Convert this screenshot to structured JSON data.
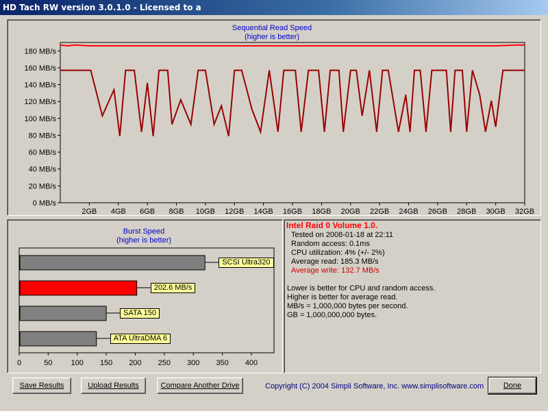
{
  "window": {
    "title": "HD Tach RW version 3.0.1.0 - Licensed to a"
  },
  "colors": {
    "accent_red": "#ff0000",
    "dark_red": "#990000",
    "bar_gray": "#808080",
    "label_bg": "#ffff99",
    "title_blue": "#0000cc"
  },
  "chart_data": [
    {
      "type": "line",
      "title": "Sequential Read Speed",
      "subtitle": "(higher is better)",
      "xlabel": "",
      "ylabel": "",
      "ylim": [
        0,
        190
      ],
      "xlim": [
        0,
        32
      ],
      "y_ticks": [
        "0 MB/s",
        "20 MB/s",
        "40 MB/s",
        "60 MB/s",
        "80 MB/s",
        "100 MB/s",
        "120 MB/s",
        "140 MB/s",
        "160 MB/s",
        "180 MB/s"
      ],
      "y_tick_values": [
        0,
        20,
        40,
        60,
        80,
        100,
        120,
        140,
        160,
        180
      ],
      "x_ticks": [
        "2GB",
        "4GB",
        "6GB",
        "8GB",
        "10GB",
        "12GB",
        "14GB",
        "16GB",
        "18GB",
        "20GB",
        "22GB",
        "24GB",
        "26GB",
        "28GB",
        "30GB",
        "32GB"
      ],
      "x_tick_values": [
        2,
        4,
        6,
        8,
        10,
        12,
        14,
        16,
        18,
        20,
        22,
        24,
        26,
        28,
        30,
        32
      ],
      "grid": false,
      "series": [
        {
          "name": "Average read",
          "color": "#ff0000",
          "x": [
            0,
            0.5,
            1,
            2,
            4,
            6,
            8,
            10,
            12,
            14,
            16,
            18,
            20,
            22,
            24,
            26,
            28,
            30,
            31.5,
            32
          ],
          "y": [
            187,
            186,
            187,
            186,
            186,
            186,
            186,
            186,
            186,
            186,
            186,
            186,
            186,
            186,
            186,
            186,
            186,
            186,
            187,
            187
          ]
        },
        {
          "name": "Average write",
          "color": "#990000",
          "x": [
            0,
            1.2,
            2.1,
            2.9,
            3.7,
            4.1,
            4.5,
            5.1,
            5.6,
            6.0,
            6.4,
            6.8,
            7.1,
            7.4,
            7.7,
            8.3,
            9.0,
            9.5,
            10.0,
            10.6,
            11.1,
            11.6,
            12.0,
            12.5,
            13.2,
            13.8,
            14.4,
            15.0,
            15.4,
            16.2,
            16.6,
            17.1,
            17.8,
            18.2,
            18.6,
            19.2,
            19.5,
            20.0,
            20.4,
            20.8,
            21.3,
            21.8,
            22.2,
            22.6,
            23.3,
            23.8,
            24.1,
            24.4,
            24.8,
            25.2,
            25.6,
            26.1,
            26.6,
            26.9,
            27.2,
            27.7,
            28.0,
            28.4,
            28.9,
            29.3,
            29.7,
            30.0,
            30.5,
            30.9,
            31.2,
            32
          ],
          "y": [
            157,
            157,
            157,
            103,
            134,
            79,
            157,
            157,
            84,
            142,
            79,
            157,
            157,
            157,
            93,
            122,
            93,
            157,
            157,
            93,
            115,
            79,
            157,
            157,
            111,
            84,
            157,
            84,
            157,
            157,
            84,
            157,
            157,
            84,
            157,
            157,
            84,
            157,
            157,
            103,
            157,
            84,
            157,
            157,
            84,
            128,
            84,
            157,
            157,
            84,
            157,
            157,
            157,
            84,
            157,
            157,
            84,
            157,
            128,
            84,
            121,
            90,
            157,
            157,
            157,
            157
          ]
        }
      ]
    },
    {
      "type": "bar",
      "orientation": "horizontal",
      "title": "Burst Speed",
      "subtitle": "(higher is better)",
      "xlim": [
        0,
        440
      ],
      "x_ticks": [
        "0",
        "50",
        "100",
        "150",
        "200",
        "250",
        "300",
        "350",
        "400"
      ],
      "x_tick_values": [
        0,
        50,
        100,
        150,
        200,
        250,
        300,
        350,
        400
      ],
      "categories": [
        "SCSI Ultra320",
        "202.6 MB/s",
        "SATA 150",
        "ATA UltraDMA 6"
      ],
      "values": [
        320,
        202.6,
        150,
        133
      ],
      "bar_colors": [
        "#808080",
        "#ff0000",
        "#808080",
        "#808080"
      ]
    }
  ],
  "info": {
    "title": "Intel Raid 0 Volume 1.0.",
    "tested": "Tested on 2008-01-18 at 22:11",
    "random_access": "Random access: 0.1ms",
    "cpu": "CPU utilization: 4% (+/- 2%)",
    "avg_read": "Average read: 185.3 MB/s",
    "avg_write": "Average write: 132.7 MB/s",
    "note1": "Lower is better for CPU and random access.",
    "note2": "Higher is better for average read.",
    "note3": "MB/s = 1,000,000 bytes per second.",
    "note4": "GB = 1,000,000,000 bytes."
  },
  "buttons": {
    "save": "Save Results",
    "upload": "Upload Results",
    "compare": "Compare Another Drive",
    "done": "Done"
  },
  "footer": {
    "copyright": "Copyright (C) 2004 Simpli Software, Inc. www.simplisoftware.com"
  }
}
